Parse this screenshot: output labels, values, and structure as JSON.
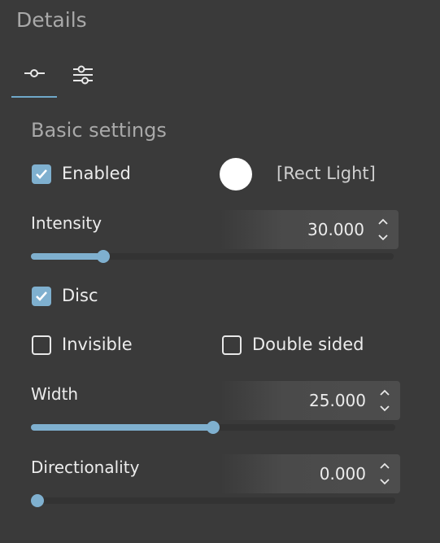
{
  "panel": {
    "title": "Details"
  },
  "tabs": [
    {
      "icon": "single-slider-icon",
      "active": true
    },
    {
      "icon": "sliders-icon",
      "active": false
    }
  ],
  "section": {
    "title": "Basic settings"
  },
  "enabled": {
    "label": "Enabled",
    "checked": true
  },
  "light_color": "#ffffff",
  "light_name": "[Rect Light]",
  "intensity": {
    "label": "Intensity",
    "value": "30.000",
    "slider_fraction": 0.2
  },
  "disc": {
    "label": "Disc",
    "checked": true
  },
  "invisible": {
    "label": "Invisible",
    "checked": false
  },
  "double_sided": {
    "label": "Double sided",
    "checked": false
  },
  "width": {
    "label": "Width",
    "value": "25.000",
    "slider_fraction": 0.5
  },
  "directionality": {
    "label": "Directionality",
    "value": "0.000",
    "slider_fraction": 0.0
  },
  "colors": {
    "accent": "#7fb0cf",
    "background": "#3a3a3a",
    "text": "#ececec",
    "muted": "#a9a9a9"
  }
}
